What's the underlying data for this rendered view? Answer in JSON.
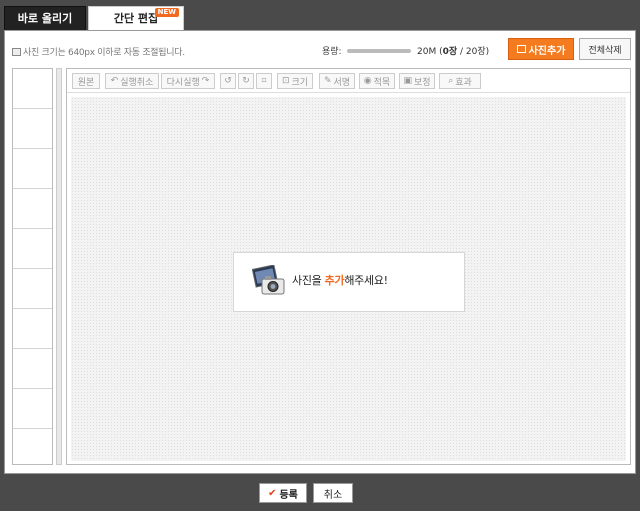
{
  "tabs": {
    "direct_upload": "바로 올리기",
    "simple_edit": "간단 편집",
    "new_badge": "NEW"
  },
  "header": {
    "notice": "사진 크기는 640px 이하로 자동 조절됩니다.",
    "capacity_label": "용량:",
    "capacity_total": "20M",
    "capacity_count_prefix": "(",
    "capacity_count": "0장",
    "capacity_count_suffix": " / 20장)",
    "capacity_fraction": 0,
    "add_photo_button": "사진추가",
    "delete_all_button": "전체삭제",
    "accent_color": "#f47b20"
  },
  "toolbar": {
    "original": "원본",
    "undo": "실행취소",
    "redo": "다시실행",
    "rotate_left_icon": "↺",
    "rotate_right_icon": "↻",
    "crop_icon": "⌗",
    "resize": "크기",
    "signature": "서명",
    "redeye": "적목",
    "correct": "보정",
    "effect": "효과"
  },
  "canvas": {
    "prompt_before": "사진을 ",
    "prompt_highlight": "추가",
    "prompt_after": "해주세요!",
    "icon": "camera-photo-icon"
  },
  "footer": {
    "register_button": "등록",
    "cancel_button": "취소"
  }
}
